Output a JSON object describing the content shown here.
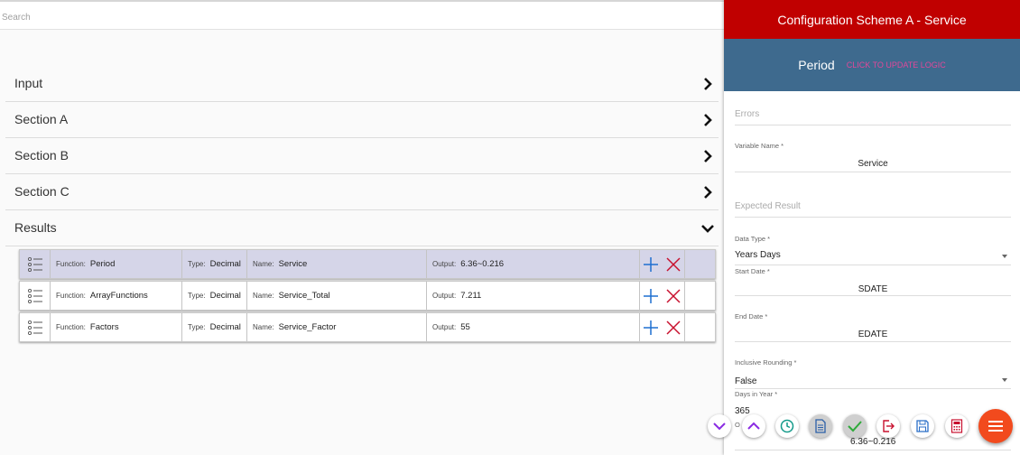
{
  "search": {
    "placeholder": "Search"
  },
  "sections": [
    {
      "label": "Input",
      "expanded": false
    },
    {
      "label": "Section A",
      "expanded": false
    },
    {
      "label": "Section B",
      "expanded": false
    },
    {
      "label": "Section C",
      "expanded": false
    },
    {
      "label": "Results",
      "expanded": true
    }
  ],
  "rows": [
    {
      "function_key": "Function:",
      "function": "Period",
      "type_key": "Type:",
      "type": "Decimal",
      "name_key": "Name:",
      "name": "Service",
      "output_key": "Output:",
      "output": "6.36~0.216",
      "selected": true
    },
    {
      "function_key": "Function:",
      "function": "ArrayFunctions",
      "type_key": "Type:",
      "type": "Decimal",
      "name_key": "Name:",
      "name": "Service_Total",
      "output_key": "Output:",
      "output": "7.211",
      "selected": false
    },
    {
      "function_key": "Function:",
      "function": "Factors",
      "type_key": "Type:",
      "type": "Decimal",
      "name_key": "Name:",
      "name": "Service_Factor",
      "output_key": "Output:",
      "output": "55",
      "selected": false
    }
  ],
  "panel": {
    "title": "Configuration Scheme A - Service",
    "subtitle": "Period",
    "update_link": "CLICK TO UPDATE LOGIC",
    "errors_placeholder": "Errors",
    "variable_name_label": "Variable Name *",
    "variable_name": "Service",
    "expected_result_placeholder": "Expected Result",
    "data_type_label": "Data Type *",
    "data_type": "Years Days",
    "start_date_label": "Start Date *",
    "start_date": "SDATE",
    "end_date_label": "End Date *",
    "end_date": "EDATE",
    "inclusive_rounding_label": "Inclusive Rounding *",
    "inclusive_rounding": "False",
    "days_in_year_label": "Days in Year *",
    "days_in_year": "365",
    "output_peek_label": "O",
    "output_value": "6.36~0.216"
  },
  "colors": {
    "header_red": "#c00000",
    "subheader_blue": "#3e6a8e",
    "link_pink": "#e0489a",
    "fab_orange": "#f24a1d",
    "add_blue": "#1e6fd0",
    "delete_red": "#c8102e"
  },
  "toolbar_icons": [
    "chevron-down-icon",
    "chevron-up-icon",
    "clock-icon",
    "document-icon",
    "check-icon",
    "exit-icon",
    "save-icon",
    "calculator-icon",
    "menu-icon"
  ]
}
